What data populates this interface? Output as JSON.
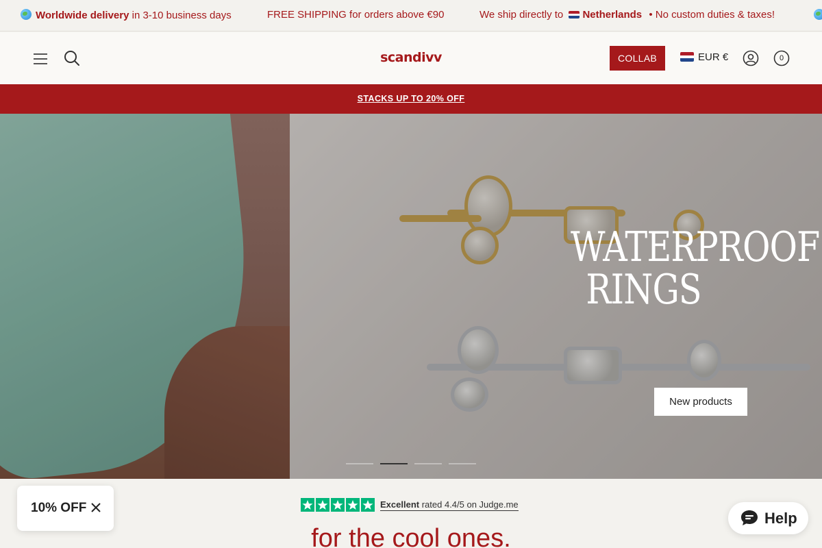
{
  "announcement": {
    "delivery_prefix": "",
    "delivery_bold": "Worldwide delivery",
    "delivery_rest": " in 3-10 business days",
    "shipping": "FREE SHIPPING for orders above €90",
    "ship_direct_prefix": "We ship directly to",
    "country": "Netherlands",
    "duties": "• No custom duties & taxes!"
  },
  "header": {
    "logo": "scandivv",
    "collab_label": "COLLAB",
    "currency": "EUR €",
    "cart_count": "0"
  },
  "promo": {
    "text": "STACKS UP TO 20% OFF"
  },
  "hero": {
    "title_line1": "WATERPROOF",
    "title_line2": "RINGS",
    "cta_label": "New products",
    "slide_count": 4,
    "active_slide": 2
  },
  "trust": {
    "rating_word": "Excellent",
    "rating_text": "rated 4.4/5 on Judge.me",
    "stars": 5
  },
  "tagline": "for the cool ones.",
  "discount_popup": {
    "label": "10% OFF"
  },
  "help_widget": {
    "label": "Help"
  },
  "colors": {
    "brand_red": "#a5191b",
    "background": "#f3f2ee",
    "star_green": "#00b67a"
  }
}
